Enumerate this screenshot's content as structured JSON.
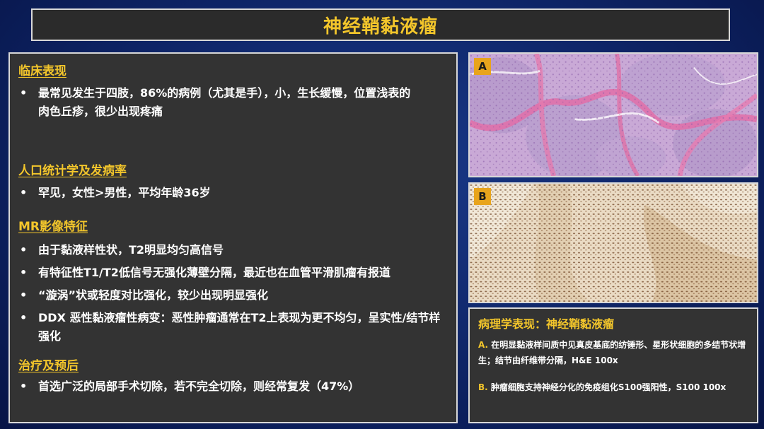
{
  "title": "神经鞘黏液瘤",
  "sections": [
    {
      "heading": "临床表现",
      "bullets": [
        "最常见发生于四肢，86%的病例（尤其是手），小，生长缓慢，位置浅表的肉色丘疹，很少出现疼痛"
      ]
    },
    {
      "heading": "人口统计学及发病率",
      "bullets": [
        "罕见，女性>男性，平均年龄36岁"
      ]
    },
    {
      "heading": "MR影像特征",
      "bullets": [
        "由于黏液样性状，T2明显均匀高信号",
        "有特征性T1/T2低信号无强化薄壁分隔，最近也在血管平滑肌瘤有报道",
        "“漩涡”状或轻度对比强化，较少出现明显强化",
        "DDX 恶性黏液瘤性病变：恶性肿瘤通常在T2上表现为更不均匀，呈实性/结节样强化"
      ]
    },
    {
      "heading": "治疗及预后",
      "bullets": [
        "首选广泛的局部手术切除，若不完全切除，则经常复发（47%）"
      ]
    }
  ],
  "images": {
    "a_label": "A",
    "b_label": "B"
  },
  "pathology": {
    "title": "病理学表现：神经鞘黏液瘤",
    "a_label": "A.",
    "a_text": "在明显黏液样间质中见真皮基底的纺锤形、星形状细胞的多结节状增生；结节由纤维带分隔，H&E 100x",
    "b_label": "B.",
    "b_text": "肿瘤细胞支持神经分化的免疫组化S100强阳性，S100 100x"
  },
  "colors": {
    "accent": "#f3c62b",
    "panel": "#333333",
    "background": "#0e2466",
    "label_badge": "#e8a41c"
  }
}
